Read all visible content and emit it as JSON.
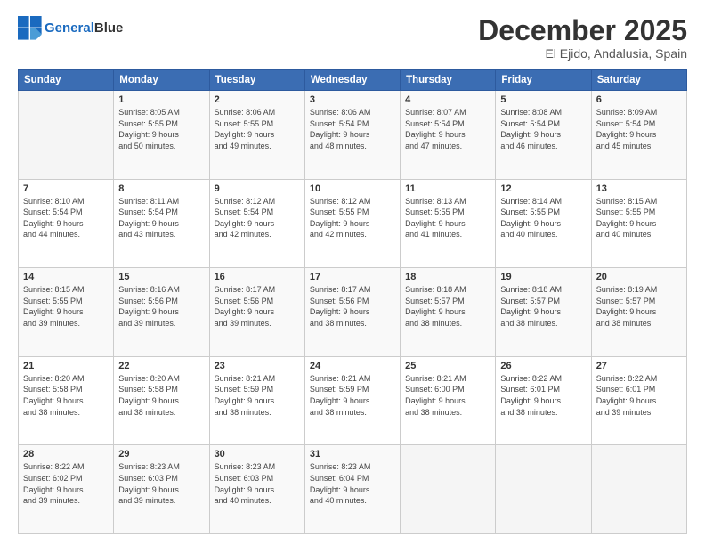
{
  "logo": {
    "line1": "General",
    "line2": "Blue"
  },
  "header": {
    "month": "December 2025",
    "location": "El Ejido, Andalusia, Spain"
  },
  "weekdays": [
    "Sunday",
    "Monday",
    "Tuesday",
    "Wednesday",
    "Thursday",
    "Friday",
    "Saturday"
  ],
  "weeks": [
    [
      {
        "day": "",
        "info": ""
      },
      {
        "day": "1",
        "info": "Sunrise: 8:05 AM\nSunset: 5:55 PM\nDaylight: 9 hours\nand 50 minutes."
      },
      {
        "day": "2",
        "info": "Sunrise: 8:06 AM\nSunset: 5:55 PM\nDaylight: 9 hours\nand 49 minutes."
      },
      {
        "day": "3",
        "info": "Sunrise: 8:06 AM\nSunset: 5:54 PM\nDaylight: 9 hours\nand 48 minutes."
      },
      {
        "day": "4",
        "info": "Sunrise: 8:07 AM\nSunset: 5:54 PM\nDaylight: 9 hours\nand 47 minutes."
      },
      {
        "day": "5",
        "info": "Sunrise: 8:08 AM\nSunset: 5:54 PM\nDaylight: 9 hours\nand 46 minutes."
      },
      {
        "day": "6",
        "info": "Sunrise: 8:09 AM\nSunset: 5:54 PM\nDaylight: 9 hours\nand 45 minutes."
      }
    ],
    [
      {
        "day": "7",
        "info": "Sunrise: 8:10 AM\nSunset: 5:54 PM\nDaylight: 9 hours\nand 44 minutes."
      },
      {
        "day": "8",
        "info": "Sunrise: 8:11 AM\nSunset: 5:54 PM\nDaylight: 9 hours\nand 43 minutes."
      },
      {
        "day": "9",
        "info": "Sunrise: 8:12 AM\nSunset: 5:54 PM\nDaylight: 9 hours\nand 42 minutes."
      },
      {
        "day": "10",
        "info": "Sunrise: 8:12 AM\nSunset: 5:55 PM\nDaylight: 9 hours\nand 42 minutes."
      },
      {
        "day": "11",
        "info": "Sunrise: 8:13 AM\nSunset: 5:55 PM\nDaylight: 9 hours\nand 41 minutes."
      },
      {
        "day": "12",
        "info": "Sunrise: 8:14 AM\nSunset: 5:55 PM\nDaylight: 9 hours\nand 40 minutes."
      },
      {
        "day": "13",
        "info": "Sunrise: 8:15 AM\nSunset: 5:55 PM\nDaylight: 9 hours\nand 40 minutes."
      }
    ],
    [
      {
        "day": "14",
        "info": "Sunrise: 8:15 AM\nSunset: 5:55 PM\nDaylight: 9 hours\nand 39 minutes."
      },
      {
        "day": "15",
        "info": "Sunrise: 8:16 AM\nSunset: 5:56 PM\nDaylight: 9 hours\nand 39 minutes."
      },
      {
        "day": "16",
        "info": "Sunrise: 8:17 AM\nSunset: 5:56 PM\nDaylight: 9 hours\nand 39 minutes."
      },
      {
        "day": "17",
        "info": "Sunrise: 8:17 AM\nSunset: 5:56 PM\nDaylight: 9 hours\nand 38 minutes."
      },
      {
        "day": "18",
        "info": "Sunrise: 8:18 AM\nSunset: 5:57 PM\nDaylight: 9 hours\nand 38 minutes."
      },
      {
        "day": "19",
        "info": "Sunrise: 8:18 AM\nSunset: 5:57 PM\nDaylight: 9 hours\nand 38 minutes."
      },
      {
        "day": "20",
        "info": "Sunrise: 8:19 AM\nSunset: 5:57 PM\nDaylight: 9 hours\nand 38 minutes."
      }
    ],
    [
      {
        "day": "21",
        "info": "Sunrise: 8:20 AM\nSunset: 5:58 PM\nDaylight: 9 hours\nand 38 minutes."
      },
      {
        "day": "22",
        "info": "Sunrise: 8:20 AM\nSunset: 5:58 PM\nDaylight: 9 hours\nand 38 minutes."
      },
      {
        "day": "23",
        "info": "Sunrise: 8:21 AM\nSunset: 5:59 PM\nDaylight: 9 hours\nand 38 minutes."
      },
      {
        "day": "24",
        "info": "Sunrise: 8:21 AM\nSunset: 5:59 PM\nDaylight: 9 hours\nand 38 minutes."
      },
      {
        "day": "25",
        "info": "Sunrise: 8:21 AM\nSunset: 6:00 PM\nDaylight: 9 hours\nand 38 minutes."
      },
      {
        "day": "26",
        "info": "Sunrise: 8:22 AM\nSunset: 6:01 PM\nDaylight: 9 hours\nand 38 minutes."
      },
      {
        "day": "27",
        "info": "Sunrise: 8:22 AM\nSunset: 6:01 PM\nDaylight: 9 hours\nand 39 minutes."
      }
    ],
    [
      {
        "day": "28",
        "info": "Sunrise: 8:22 AM\nSunset: 6:02 PM\nDaylight: 9 hours\nand 39 minutes."
      },
      {
        "day": "29",
        "info": "Sunrise: 8:23 AM\nSunset: 6:03 PM\nDaylight: 9 hours\nand 39 minutes."
      },
      {
        "day": "30",
        "info": "Sunrise: 8:23 AM\nSunset: 6:03 PM\nDaylight: 9 hours\nand 40 minutes."
      },
      {
        "day": "31",
        "info": "Sunrise: 8:23 AM\nSunset: 6:04 PM\nDaylight: 9 hours\nand 40 minutes."
      },
      {
        "day": "",
        "info": ""
      },
      {
        "day": "",
        "info": ""
      },
      {
        "day": "",
        "info": ""
      }
    ]
  ]
}
